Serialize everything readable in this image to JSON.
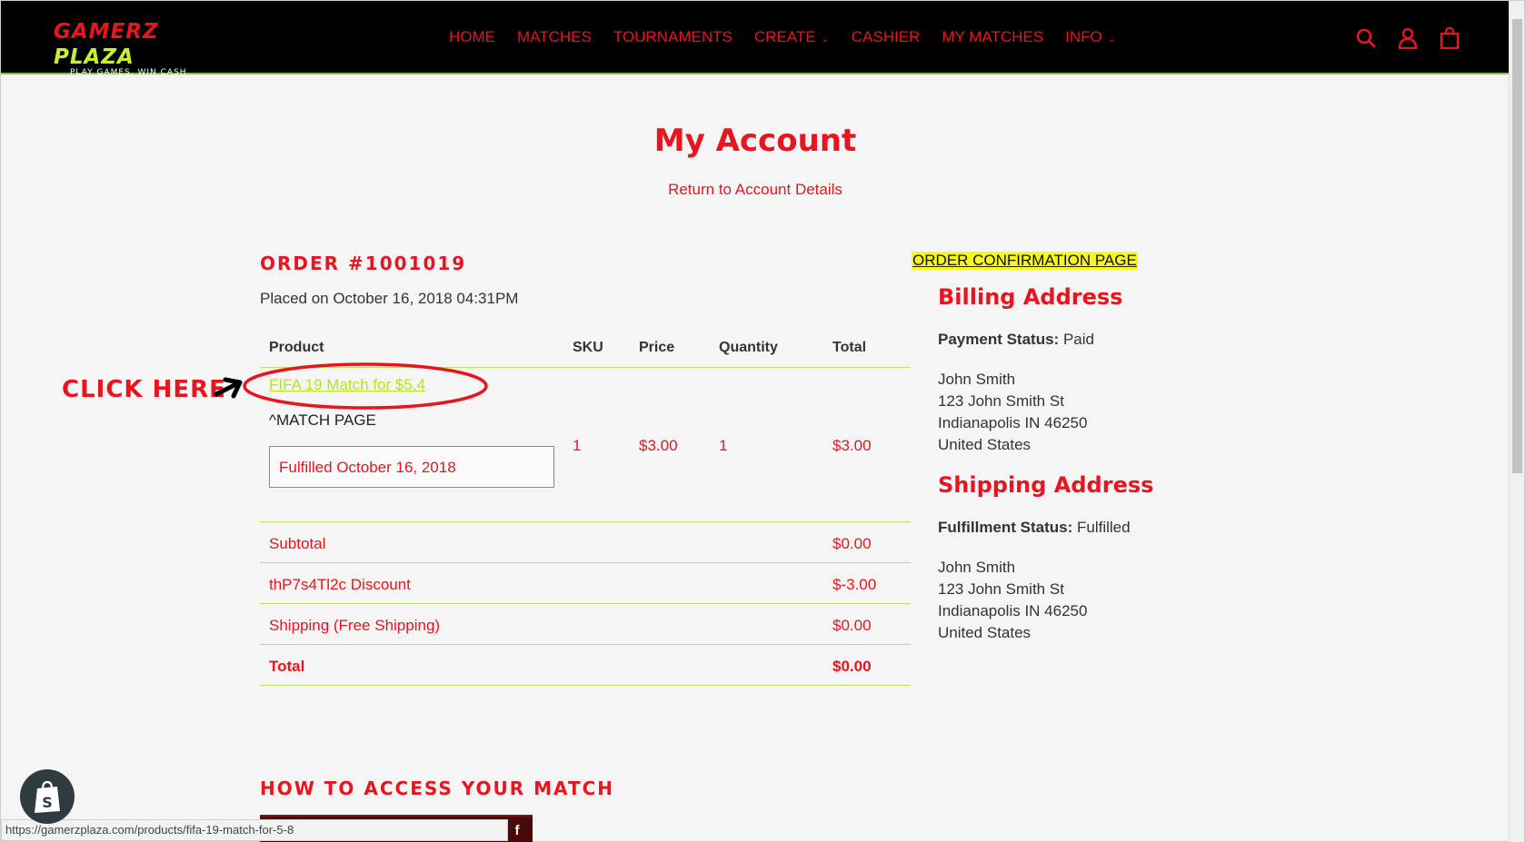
{
  "header": {
    "logo_main_1": "GAMERZ",
    "logo_main_2": "PLAZA",
    "logo_tagline": "PLAY GAMES, WIN CASH",
    "nav": [
      {
        "label": "HOME"
      },
      {
        "label": "MATCHES"
      },
      {
        "label": "TOURNAMENTS"
      },
      {
        "label": "CREATE",
        "caret": "⌄"
      },
      {
        "label": "CASHIER"
      },
      {
        "label": "MY MATCHES"
      },
      {
        "label": "INFO",
        "caret": "⌄"
      }
    ],
    "icons": [
      "search-icon",
      "user-icon",
      "cart-icon"
    ]
  },
  "page": {
    "title": "My Account",
    "return_link": "Return to Account Details"
  },
  "order": {
    "number": "ORDER #1001019",
    "placed": "Placed on October 16, 2018 04:31PM",
    "columns": [
      "Product",
      "SKU",
      "Price",
      "Quantity",
      "Total"
    ],
    "item": {
      "name": "FIFA 19 Match for $5.4",
      "note": "^MATCH PAGE",
      "fulfilled": "Fulfilled October 16, 2018",
      "sku": "1",
      "price": "$3.00",
      "quantity": "1",
      "total": "$3.00"
    },
    "summary": [
      {
        "label": "Subtotal",
        "value": "$0.00"
      },
      {
        "label": "thP7s4Tl2c Discount",
        "value": "$-3.00"
      },
      {
        "label": "Shipping (Free Shipping)",
        "value": "$0.00"
      },
      {
        "label": "Total",
        "value": "$0.00"
      }
    ]
  },
  "annotations": {
    "click_here": "CLICK HERE",
    "confirmation": "ORDER CONFIRMATION PAGE"
  },
  "billing": {
    "heading": "Billing Address",
    "status_label": "Payment Status:",
    "status_value": "Paid",
    "lines": [
      "John Smith",
      "123 John Smith St",
      "Indianapolis IN 46250",
      "United States"
    ]
  },
  "shipping": {
    "heading": "Shipping Address",
    "status_label": "Fulfillment Status:",
    "status_value": "Fulfilled",
    "lines": [
      "John Smith",
      "123 John Smith St",
      "Indianapolis IN 46250",
      "United States"
    ]
  },
  "bottom": {
    "howto": "HOW TO ACCESS YOUR MATCH",
    "status_url": "https://gamerzplaza.com/products/fifa-19-match-for-5-8",
    "fb": "f"
  },
  "colors": {
    "brand_red": "#e8141e",
    "lime": "#b5e61d",
    "highlight": "#f7f71e"
  }
}
